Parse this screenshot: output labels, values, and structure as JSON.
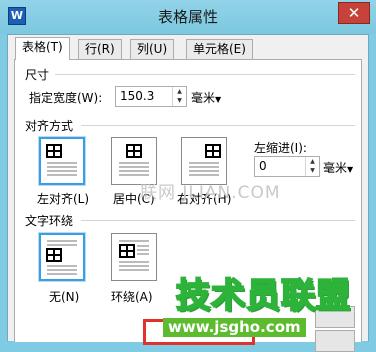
{
  "window": {
    "title": "表格属性",
    "close_glyph": "✕",
    "app_icon_letter": "W"
  },
  "tabs": [
    {
      "label": "表格(T)",
      "active": true
    },
    {
      "label": "行(R)",
      "active": false
    },
    {
      "label": "列(U)",
      "active": false
    },
    {
      "label": "单元格(E)",
      "active": false
    }
  ],
  "size_group": {
    "title": "尺寸",
    "width_label": "指定宽度(W):",
    "width_value": "150.3",
    "width_unit": "毫米"
  },
  "alignment_group": {
    "title": "对齐方式",
    "options": [
      {
        "label": "左对齐(L)",
        "selected": true,
        "icon": "align-left-icon"
      },
      {
        "label": "居中(C)",
        "selected": false,
        "icon": "align-center-icon"
      },
      {
        "label": "右对齐(H)",
        "selected": false,
        "icon": "align-right-icon"
      }
    ],
    "indent_label": "左缩进(I):",
    "indent_value": "0",
    "indent_unit": "毫米"
  },
  "wrap_group": {
    "title": "文字环绕",
    "options": [
      {
        "label": "无(N)",
        "selected": true,
        "icon": "wrap-none-icon"
      },
      {
        "label": "环绕(A)",
        "selected": false,
        "icon": "wrap-around-icon"
      }
    ]
  },
  "watermarks": {
    "faint": "联网 JLIAN.COM",
    "brand": "技术员联盟",
    "url": "www.jsgho.com"
  },
  "colors": {
    "selection": "#3b9ee0",
    "highlight": "#e0322b",
    "titlebar": "#7fcbe3"
  }
}
